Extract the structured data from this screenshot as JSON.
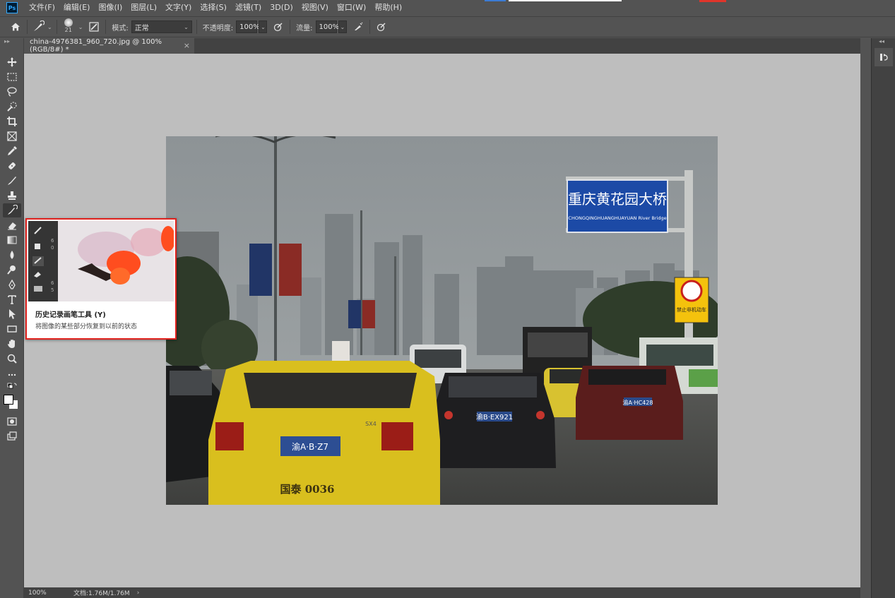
{
  "app": {
    "logo": "Ps"
  },
  "menu": [
    "文件(F)",
    "编辑(E)",
    "图像(I)",
    "图层(L)",
    "文字(Y)",
    "选择(S)",
    "滤镜(T)",
    "3D(D)",
    "视图(V)",
    "窗口(W)",
    "帮助(H)"
  ],
  "options": {
    "brush_size": "21",
    "mode_label": "模式:",
    "mode_value": "正常",
    "opacity_label": "不透明度:",
    "opacity_value": "100%",
    "flow_label": "流量:",
    "flow_value": "100%"
  },
  "tab": {
    "title": "china-4976381_960_720.jpg @ 100%(RGB/8#) *",
    "close": "×"
  },
  "status": {
    "zoom": "100%",
    "doc": "文档:1.76M/1.76M",
    "arrow": "›"
  },
  "tooltip": {
    "title": "历史记录画笔工具 (Y)",
    "desc": "将图像的某些部分恢复到以前的状态"
  },
  "photo": {
    "sign_title": "重庆黄花园大桥",
    "sign_sub": "CHONGQINGHUANGHUAYUAN River Bridge",
    "taxi_plate": "渝A·B·Z7",
    "taxi_rear": "国泰 0036",
    "car_plate": "渝B·EX921",
    "suv_plate": "渝A·HC428",
    "warning_text": "禁止非机动车",
    "taxi_brand": "SX4"
  },
  "colors": {
    "bg": "#535353",
    "panel": "#424242",
    "canvas": "#bebebe",
    "highlight": "#e0211d",
    "accent": "#31a8ff"
  }
}
